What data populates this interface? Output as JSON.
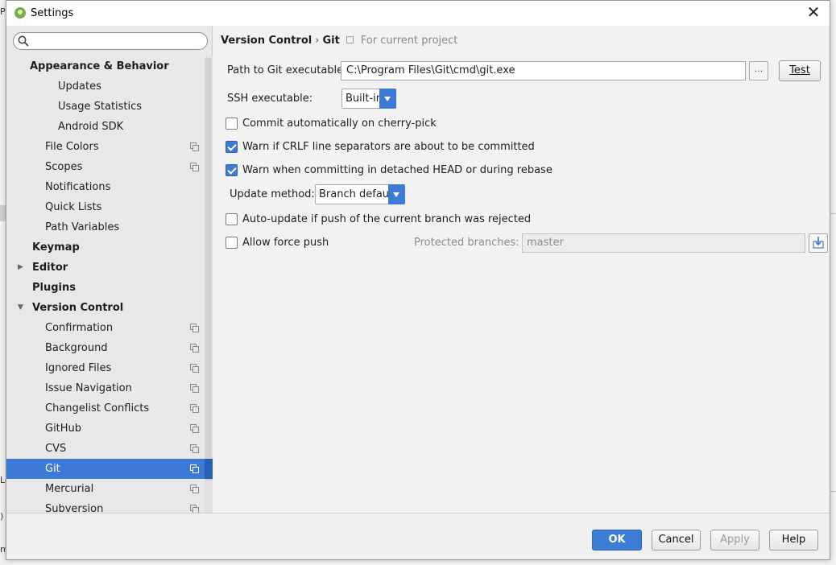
{
  "window": {
    "title": "Settings"
  },
  "background": {
    "side_texts": [
      "Pr",
      "Lo",
      ")",
      "mi"
    ]
  },
  "sidebar": {
    "search_placeholder": "",
    "items": [
      {
        "label": "Appearance & Behavior",
        "level": 0,
        "bold": true
      },
      {
        "label": "Updates",
        "level": 2
      },
      {
        "label": "Usage Statistics",
        "level": 2
      },
      {
        "label": "Android SDK",
        "level": 2
      },
      {
        "label": "File Colors",
        "level": 1,
        "project": true
      },
      {
        "label": "Scopes",
        "level": 1,
        "project": true
      },
      {
        "label": "Notifications",
        "level": 1
      },
      {
        "label": "Quick Lists",
        "level": 1
      },
      {
        "label": "Path Variables",
        "level": 1
      },
      {
        "label": "Keymap",
        "level": 0,
        "bold": true
      },
      {
        "label": "Editor",
        "level": 0,
        "bold": true,
        "arrow": "collapsed"
      },
      {
        "label": "Plugins",
        "level": 0,
        "bold": true
      },
      {
        "label": "Version Control",
        "level": 0,
        "bold": true,
        "arrow": "expanded"
      },
      {
        "label": "Confirmation",
        "level": 1,
        "project": true
      },
      {
        "label": "Background",
        "level": 1,
        "project": true
      },
      {
        "label": "Ignored Files",
        "level": 1,
        "project": true
      },
      {
        "label": "Issue Navigation",
        "level": 1,
        "project": true
      },
      {
        "label": "Changelist Conflicts",
        "level": 1,
        "project": true
      },
      {
        "label": "GitHub",
        "level": 1,
        "project": true
      },
      {
        "label": "CVS",
        "level": 1,
        "project": true
      },
      {
        "label": "Git",
        "level": 1,
        "project": true,
        "selected": true
      },
      {
        "label": "Mercurial",
        "level": 1,
        "project": true
      },
      {
        "label": "Subversion",
        "level": 1,
        "project": true
      }
    ]
  },
  "breadcrumb": {
    "parent": "Version Control",
    "separator": "›",
    "current": "Git",
    "scope": "For current project"
  },
  "git": {
    "path_label": "Path to Git executable:",
    "path_value": "C:\\Program Files\\Git\\cmd\\git.exe",
    "browse_label": "...",
    "test_label": "Test",
    "ssh_label": "SSH executable:",
    "ssh_value": "Built-in",
    "commit_cherry_pick": {
      "label": "Commit automatically on cherry-pick",
      "checked": false
    },
    "warn_crlf": {
      "label": "Warn if CRLF line separators are about to be committed",
      "checked": true
    },
    "warn_detached": {
      "label": "Warn when committing in detached HEAD or during rebase",
      "checked": true
    },
    "update_method_label": "Update method:",
    "update_method_value": "Branch default",
    "auto_update": {
      "label": "Auto-update if push of the current branch was rejected",
      "checked": false
    },
    "allow_force_push": {
      "label": "Allow force push",
      "checked": false
    },
    "protected_label": "Protected branches:",
    "protected_value": "master"
  },
  "footer": {
    "ok": "OK",
    "cancel": "Cancel",
    "apply": "Apply",
    "help": "Help"
  },
  "colors": {
    "accent": "#3d79d6",
    "selection": "#3d79d6"
  }
}
